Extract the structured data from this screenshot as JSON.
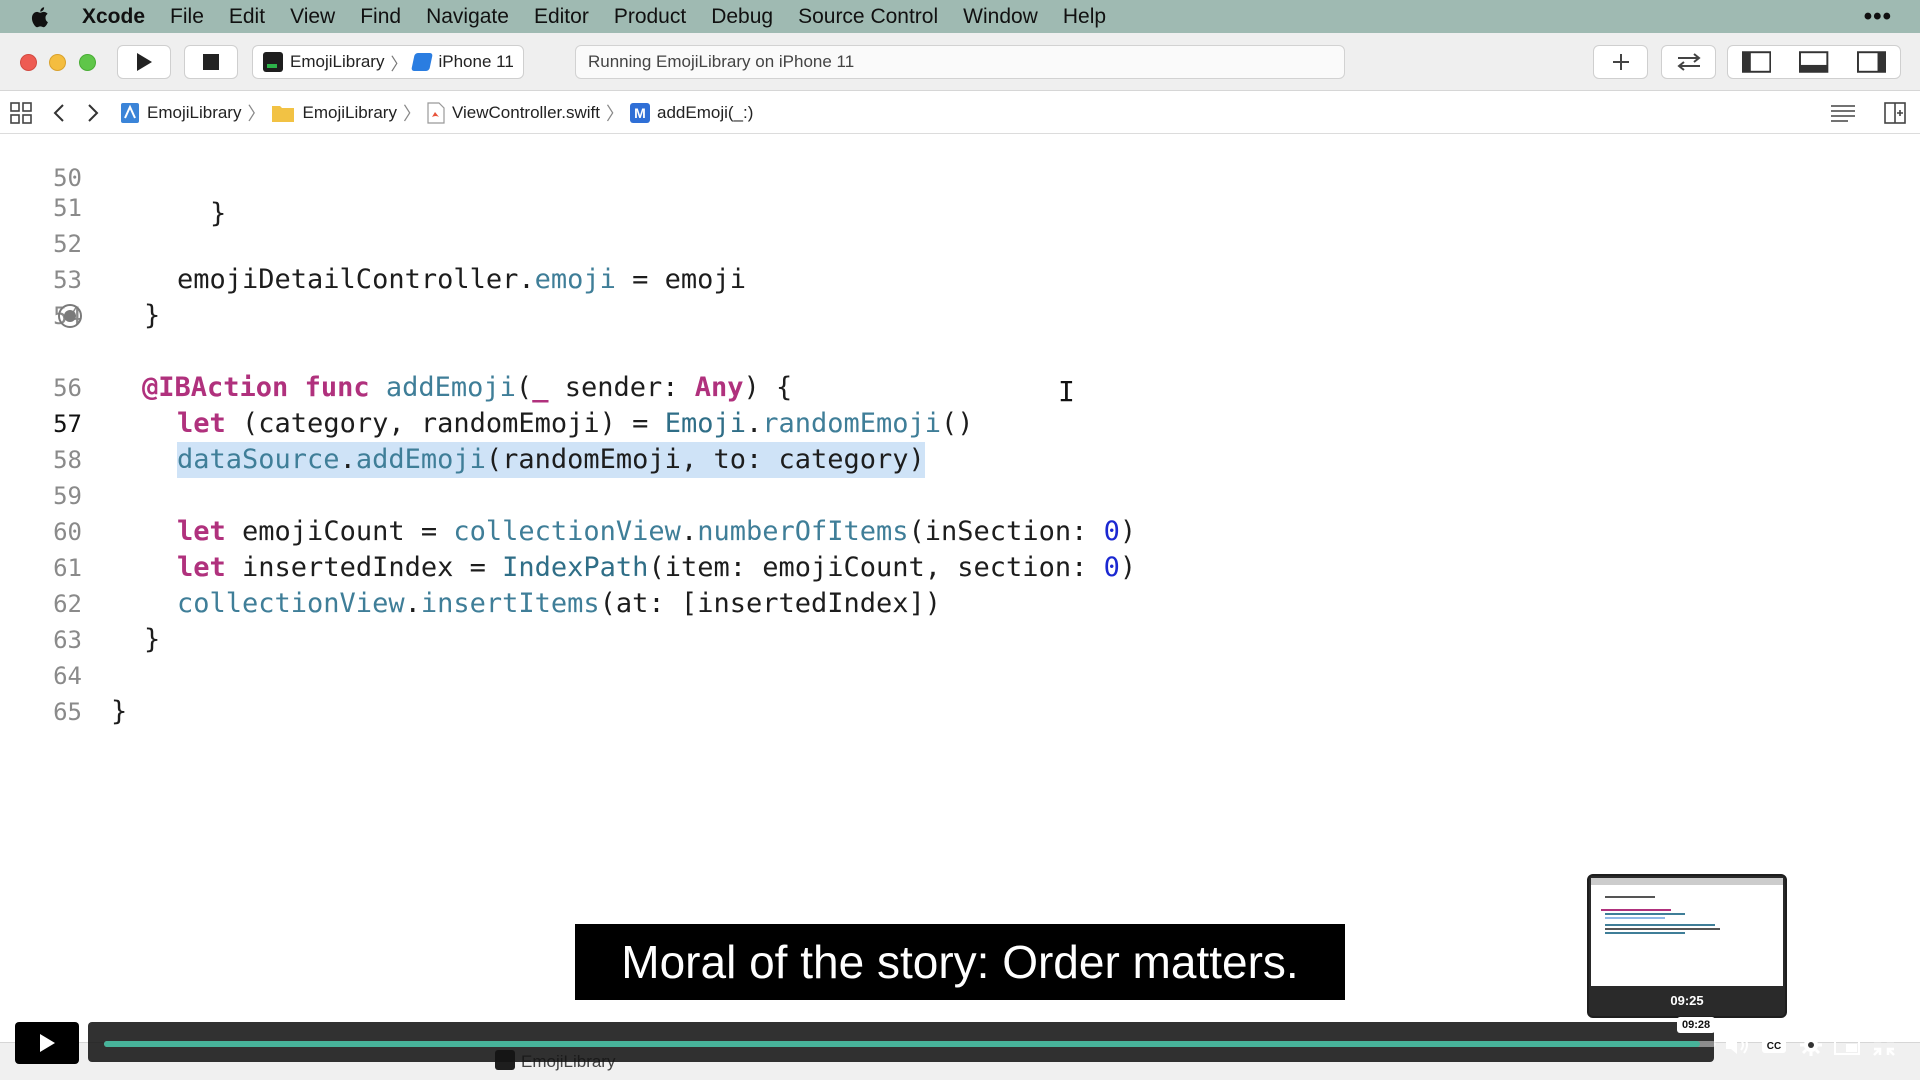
{
  "menubar": {
    "app_name": "Xcode",
    "items": [
      "File",
      "Edit",
      "View",
      "Find",
      "Navigate",
      "Editor",
      "Product",
      "Debug",
      "Source Control",
      "Window",
      "Help"
    ],
    "more": "•••"
  },
  "toolbar": {
    "scheme_name": "EmojiLibrary",
    "destination": "iPhone 11",
    "activity_status": "Running EmojiLibrary on iPhone 11"
  },
  "jumpbar": {
    "crumbs": [
      "EmojiLibrary",
      "EmojiLibrary",
      "ViewController.swift",
      "addEmoji(_:)"
    ]
  },
  "editor": {
    "line_numbers": [
      "50",
      "51",
      "52",
      "53",
      "54",
      "55",
      "56",
      "57",
      "58",
      "59",
      "60",
      "61",
      "62",
      "63",
      "64",
      "65"
    ],
    "current_line": "57",
    "lines": {
      "l50": "    }",
      "l52_a": "emojiDetailController.",
      "l52_b": "emoji",
      "l52_c": " = emoji",
      "l53": "}",
      "l55_a": "@IBAction",
      "l55_b": "func",
      "l55_c": "addEmoji",
      "l55_d": "(",
      "l55_e": "_",
      "l55_f": " sender: ",
      "l55_g": "Any",
      "l55_h": ") {",
      "l56_a": "let",
      "l56_b": " (category, randomEmoji) = ",
      "l56_c": "Emoji",
      "l56_d": ".",
      "l56_e": "randomEmoji",
      "l56_f": "()",
      "l57_a": "dataSource",
      "l57_b": ".",
      "l57_c": "addEmoji",
      "l57_d": "(randomEmoji, to: category)",
      "l59_a": "let",
      "l59_b": " emojiCount = ",
      "l59_c": "collectionView",
      "l59_d": ".",
      "l59_e": "numberOfItems",
      "l59_f": "(inSection: ",
      "l59_g": "0",
      "l59_h": ")",
      "l60_a": "let",
      "l60_b": " insertedIndex = ",
      "l60_c": "IndexPath",
      "l60_d": "(item: emojiCount, section: ",
      "l60_e": "0",
      "l60_f": ")",
      "l61_a": "collectionView",
      "l61_b": ".",
      "l61_c": "insertItems",
      "l61_d": "(at: [insertedIndex])",
      "l62": "}",
      "l64": "}"
    }
  },
  "debugbar": {
    "target_label": "EmojiLibrary"
  },
  "video": {
    "caption": "Moral of the story: Order matters.",
    "thumbnail_time": "09:25",
    "hover_time": "09:28",
    "progress_fraction": 0.99,
    "accent_color": "#47b39a"
  }
}
